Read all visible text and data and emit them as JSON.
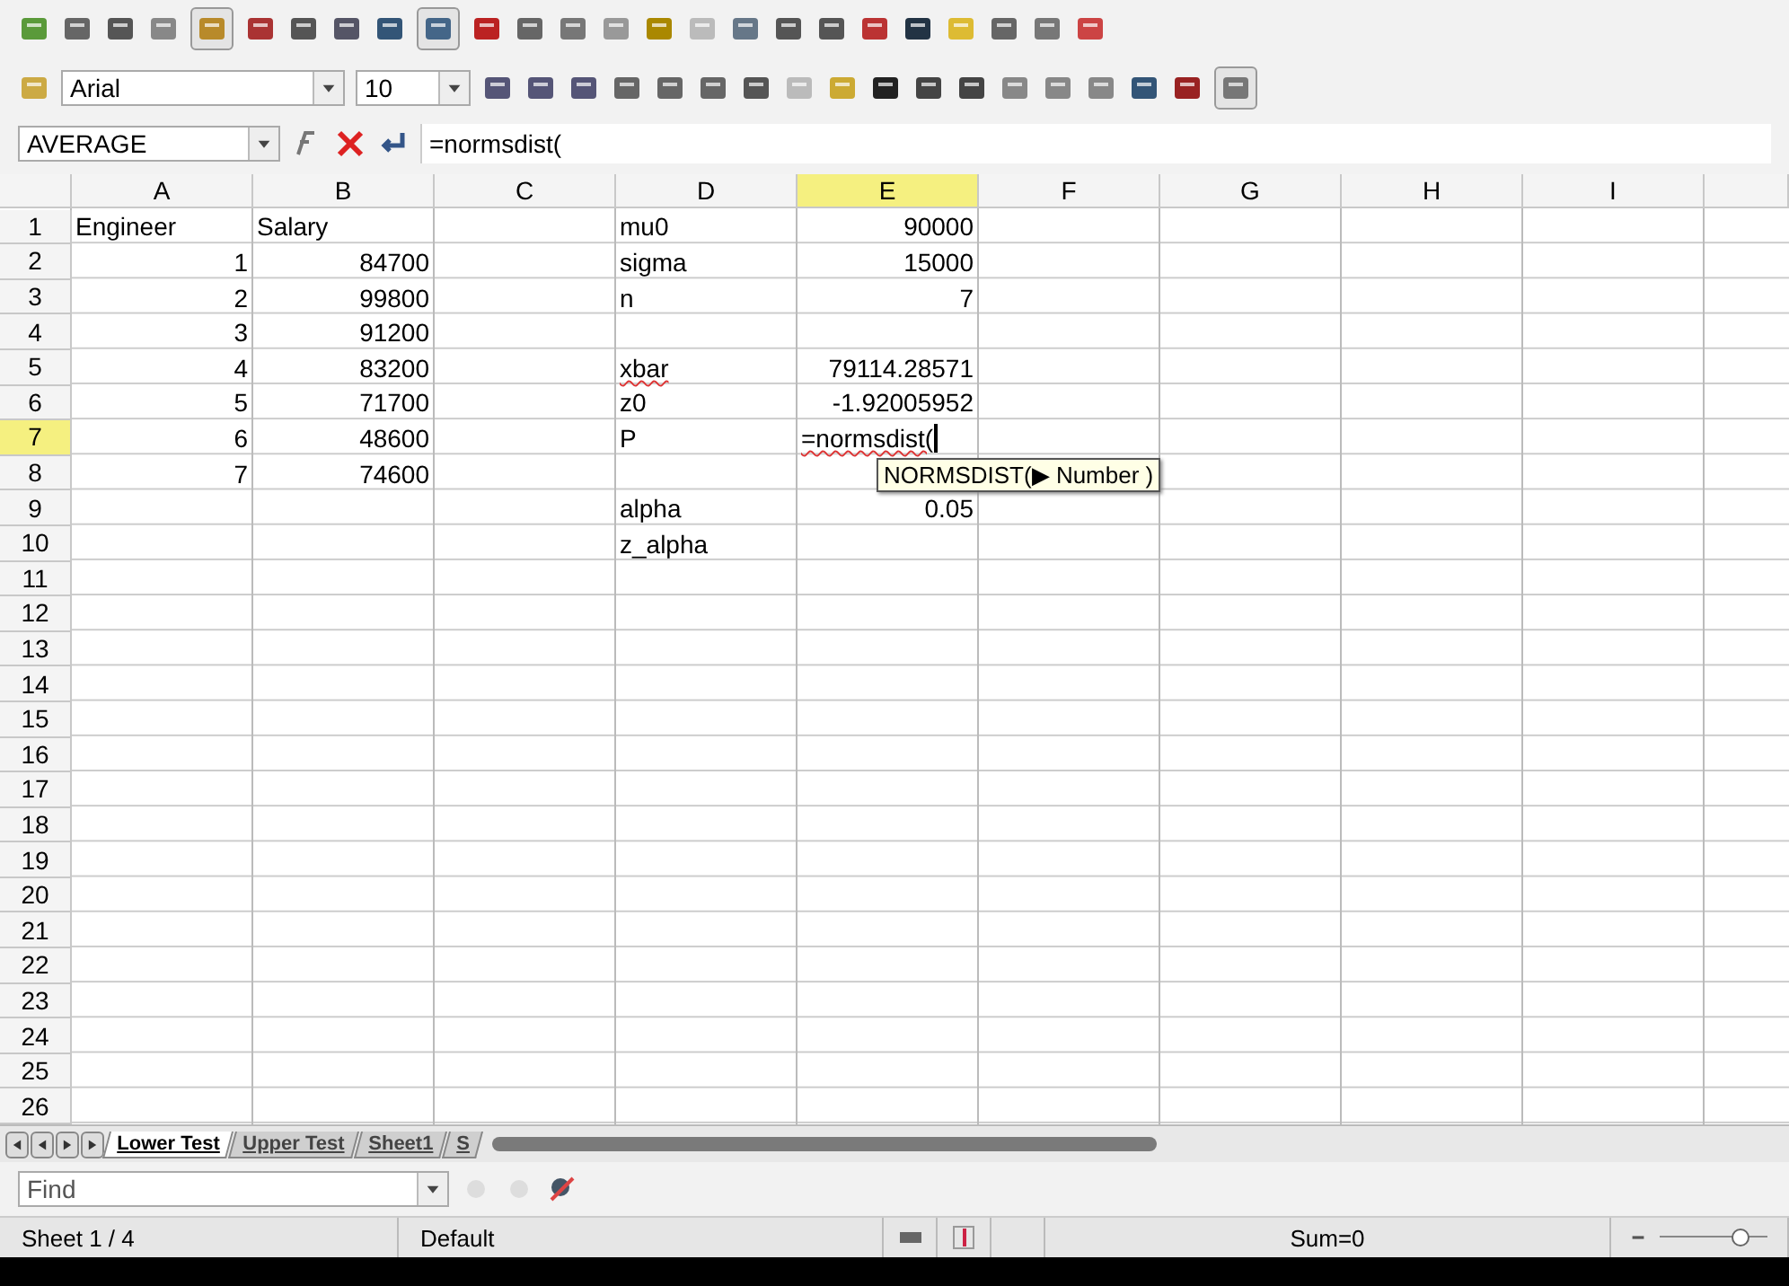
{
  "toolbar": {
    "font": "Arial",
    "size": "10"
  },
  "formula_bar": {
    "name_box": "AVERAGE",
    "formula": "=normsdist("
  },
  "columns": [
    {
      "label": "A",
      "selected": false
    },
    {
      "label": "B",
      "selected": false
    },
    {
      "label": "C",
      "selected": false
    },
    {
      "label": "D",
      "selected": false
    },
    {
      "label": "E",
      "selected": true
    },
    {
      "label": "F",
      "selected": false
    },
    {
      "label": "G",
      "selected": false
    },
    {
      "label": "H",
      "selected": false
    },
    {
      "label": "I",
      "selected": false
    }
  ],
  "rows": [
    {
      "label": "1",
      "selected": false,
      "cells": {
        "A": {
          "text": "Engineer",
          "kind": "text"
        },
        "B": {
          "text": "Salary",
          "kind": "text"
        },
        "D": {
          "text": "mu0",
          "kind": "text"
        },
        "E": {
          "text": "90000",
          "kind": "number"
        }
      }
    },
    {
      "label": "2",
      "selected": false,
      "cells": {
        "A": {
          "text": "1",
          "kind": "number"
        },
        "B": {
          "text": "84700",
          "kind": "number"
        },
        "D": {
          "text": "sigma",
          "kind": "text"
        },
        "E": {
          "text": "15000",
          "kind": "number"
        }
      }
    },
    {
      "label": "3",
      "selected": false,
      "cells": {
        "A": {
          "text": "2",
          "kind": "number"
        },
        "B": {
          "text": "99800",
          "kind": "number"
        },
        "D": {
          "text": "n",
          "kind": "text"
        },
        "E": {
          "text": "7",
          "kind": "number"
        }
      }
    },
    {
      "label": "4",
      "selected": false,
      "cells": {
        "A": {
          "text": "3",
          "kind": "number"
        },
        "B": {
          "text": "91200",
          "kind": "number"
        }
      }
    },
    {
      "label": "5",
      "selected": false,
      "cells": {
        "A": {
          "text": "4",
          "kind": "number"
        },
        "B": {
          "text": "83200",
          "kind": "number"
        },
        "D": {
          "text": "xbar",
          "kind": "misspelled"
        },
        "E": {
          "text": "79114.28571",
          "kind": "number"
        }
      }
    },
    {
      "label": "6",
      "selected": false,
      "cells": {
        "A": {
          "text": "5",
          "kind": "number"
        },
        "B": {
          "text": "71700",
          "kind": "number"
        },
        "D": {
          "text": "z0",
          "kind": "text"
        },
        "E": {
          "text": "-1.92005952",
          "kind": "number"
        }
      }
    },
    {
      "label": "7",
      "selected": true,
      "cells": {
        "A": {
          "text": "6",
          "kind": "number"
        },
        "B": {
          "text": "48600",
          "kind": "number"
        },
        "D": {
          "text": "P",
          "kind": "text"
        },
        "E": {
          "text": "=normsdist(",
          "kind": "editing"
        }
      }
    },
    {
      "label": "8",
      "selected": false,
      "cells": {
        "A": {
          "text": "7",
          "kind": "number"
        },
        "B": {
          "text": "74600",
          "kind": "number"
        }
      }
    },
    {
      "label": "9",
      "selected": false,
      "cells": {
        "D": {
          "text": "alpha",
          "kind": "text"
        },
        "E": {
          "text": "0.05",
          "kind": "number"
        }
      }
    },
    {
      "label": "10",
      "selected": false,
      "cells": {
        "D": {
          "text": "z_alpha",
          "kind": "text"
        }
      }
    },
    {
      "label": "11",
      "selected": false,
      "cells": {}
    },
    {
      "label": "12",
      "selected": false,
      "cells": {}
    },
    {
      "label": "13",
      "selected": false,
      "cells": {}
    },
    {
      "label": "14",
      "selected": false,
      "cells": {}
    },
    {
      "label": "15",
      "selected": false,
      "cells": {}
    },
    {
      "label": "16",
      "selected": false,
      "cells": {}
    },
    {
      "label": "17",
      "selected": false,
      "cells": {}
    },
    {
      "label": "18",
      "selected": false,
      "cells": {}
    },
    {
      "label": "19",
      "selected": false,
      "cells": {}
    },
    {
      "label": "20",
      "selected": false,
      "cells": {}
    },
    {
      "label": "21",
      "selected": false,
      "cells": {}
    },
    {
      "label": "22",
      "selected": false,
      "cells": {}
    },
    {
      "label": "23",
      "selected": false,
      "cells": {}
    },
    {
      "label": "24",
      "selected": false,
      "cells": {}
    },
    {
      "label": "25",
      "selected": false,
      "cells": {}
    },
    {
      "label": "26",
      "selected": false,
      "cells": {}
    }
  ],
  "tooltip": "NORMSDIST(▶ Number )",
  "sheet_tabs": [
    {
      "label": "Lower Test",
      "selected": true
    },
    {
      "label": "Upper Test",
      "selected": false
    },
    {
      "label": "Sheet1",
      "selected": false
    },
    {
      "label": "S",
      "selected": false
    }
  ],
  "find_bar": {
    "placeholder": "Find"
  },
  "status_bar": {
    "sheet": "Sheet 1 / 4",
    "style": "Default",
    "sum": "Sum=0",
    "zoom": {
      "level": 0.75
    }
  }
}
